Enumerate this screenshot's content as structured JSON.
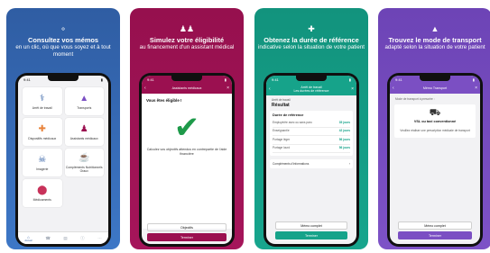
{
  "cards": [
    {
      "headline_bold": "Consultez vos mémos",
      "headline_thin": "en un clic, où que vous soyez et à tout moment",
      "hero_icon": "lightbulb-icon",
      "screen": {
        "time": "9:41",
        "tiles": [
          {
            "label": "Arrêt de travail",
            "icon": "stethoscope-icon"
          },
          {
            "label": "Transports",
            "icon": "road-icon"
          },
          {
            "label": "Dispositifs médicaux",
            "icon": "bandage-icon"
          },
          {
            "label": "Assistants médicaux",
            "icon": "people-icon"
          },
          {
            "label": "Imagerie",
            "icon": "xray-icon"
          },
          {
            "label": "Compléments Nutritionnels Oraux",
            "icon": "glass-icon"
          },
          {
            "label": "Médicaments",
            "icon": "pills-icon"
          }
        ],
        "tabs": [
          "Accueil",
          "",
          "",
          "",
          ""
        ]
      }
    },
    {
      "headline_bold": "Simulez votre éligibilité",
      "headline_thin": "au financement d'un assistant médical",
      "hero_icon": "people-icon",
      "screen": {
        "time": "9:41",
        "nav_title": "Assistants médicaux",
        "question": "Vous êtes éligible !",
        "message": "Calculez vos objectifs attendus en contrepartie de l'aide financière",
        "button_secondary": "Objectifs",
        "button_primary": "Terminer"
      }
    },
    {
      "headline_bold": "Obtenez la durée de référence",
      "headline_thin": "indicative selon la situation de votre patient",
      "hero_icon": "bandage-icon",
      "screen": {
        "time": "9:41",
        "nav_title": "Arrêt de travail",
        "nav_subtitle": "Les durées de référence",
        "subhead": "Arrêt de travail",
        "result_title": "Résultat",
        "panel_title": "Durée de référence",
        "rows": [
          {
            "label": "Employé/ée avec ou sans paro",
            "value": "35 jours"
          },
          {
            "label": "Enseignant/e",
            "value": "42 jours"
          },
          {
            "label": "Portage léger",
            "value": "56 jours"
          },
          {
            "label": "Portage lourd",
            "value": "56 jours"
          }
        ],
        "complements": "Compléments d'informations",
        "button_secondary": "Mémo complet",
        "button_primary": "Terminer"
      }
    },
    {
      "headline_bold": "Trouvez le mode de transport",
      "headline_thin": "adapté selon la situation de votre patient",
      "hero_icon": "road-icon",
      "screen": {
        "time": "9:41",
        "nav_title": "Mémo Transport",
        "prompt": "Mode de transport à prescrire :",
        "transport_title": "VSL ou taxi conventionné",
        "transport_desc": "Veuillez réaliser une prescription médicale de transport",
        "button_secondary": "Mémo complet",
        "button_primary": "Terminer"
      }
    }
  ],
  "colors": {
    "blue": "#2f5da3",
    "magenta": "#9b1050",
    "teal": "#16a38a",
    "purple": "#7b4fc3"
  }
}
